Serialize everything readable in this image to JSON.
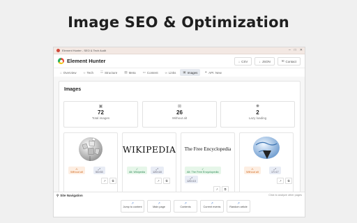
{
  "page_heading": "Image SEO & Optimization",
  "window": {
    "title": "Element Hunter - SEO & Tech Audit"
  },
  "app": {
    "name": "Element Hunter",
    "buttons": {
      "csv": "CSV",
      "json": "JSON",
      "contact": "Contact"
    }
  },
  "tabs": [
    {
      "label": "Overview",
      "icon": "home-icon"
    },
    {
      "label": "Tech",
      "icon": "code-icon"
    },
    {
      "label": "Structure",
      "icon": "structure-icon"
    },
    {
      "label": "Meta",
      "icon": "meta-icon"
    },
    {
      "label": "Content",
      "icon": "content-icon"
    },
    {
      "label": "Links",
      "icon": "link-icon"
    },
    {
      "label": "Images",
      "icon": "image-icon",
      "active": true
    },
    {
      "label": "API: New",
      "icon": "api-icon"
    }
  ],
  "images_panel": {
    "title": "Images",
    "stats": [
      {
        "value": "72",
        "label": "Total images"
      },
      {
        "value": "26",
        "label": "Without alt"
      },
      {
        "value": "2",
        "label": "Lazy loading"
      }
    ],
    "cards": [
      {
        "thumb": "globe-puzzle",
        "alt_chip": "Without alt",
        "alt_status": "warn",
        "size": "53×53"
      },
      {
        "thumb_text": "WIKIPEDIA",
        "alt_chip": "Alt: Wikipedia",
        "alt_status": "ok",
        "size": "120×18"
      },
      {
        "thumb_text": "The Free Encyclopedia",
        "alt_chip": "Alt: The Free Encyclopedia",
        "alt_status": "ok",
        "size": "120×13"
      },
      {
        "thumb": "wikinews-globe",
        "alt_chip": "Without alt",
        "alt_status": "warn",
        "size": "17×17"
      }
    ]
  },
  "site_navigation": {
    "title": "Site Navigation",
    "hint": "Click to analyze other pages",
    "links": [
      "Jump to content",
      "Main page",
      "Contents",
      "Current events",
      "Random article"
    ]
  },
  "colors": {
    "warn": "#d2691e",
    "ok": "#2e8b57",
    "accent": "#4a7fd0"
  }
}
